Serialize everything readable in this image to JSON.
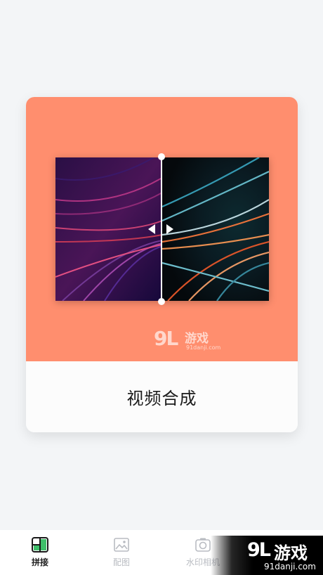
{
  "feature_card": {
    "title": "视频合成",
    "accent_color": "#ff8e6e",
    "watermark": {
      "logo": "9L",
      "text": "游戏",
      "url": "91danji.com"
    }
  },
  "tabbar": {
    "tabs": [
      {
        "label": "拼接",
        "icon": "splice-icon",
        "active": true
      },
      {
        "label": "配图",
        "icon": "image-icon",
        "active": false
      },
      {
        "label": "水印相机",
        "icon": "camera-icon",
        "active": false
      }
    ]
  },
  "site_watermark": {
    "logo": "9L",
    "text": "游戏",
    "url": "91danji.com"
  }
}
